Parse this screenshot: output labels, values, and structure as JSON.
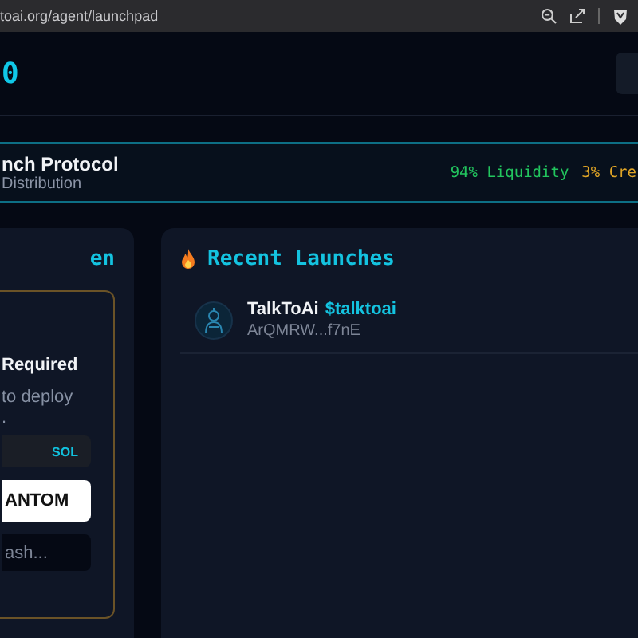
{
  "browser": {
    "url": "toai.org/agent/launchpad"
  },
  "header": {
    "logo_fragment": "0"
  },
  "banner": {
    "title": "nch Protocol",
    "subtitle": "Distribution",
    "stats": [
      {
        "text": "94% Liquidity",
        "color": "#22c55e"
      },
      {
        "text": "3% Cre",
        "color": "#e0a526"
      }
    ]
  },
  "left_panel": {
    "title": "en",
    "card": {
      "heading": "Required",
      "text_lines": [
        "to deploy",
        "."
      ],
      "amount": "SOL",
      "button": "ANTOM",
      "input": {
        "placeholder": "ash..."
      }
    }
  },
  "right_panel": {
    "title": "Recent Launches",
    "launches": [
      {
        "name": "TalkToAi",
        "ticker": "$talktoai",
        "address": "ArQMRW...f7nE"
      }
    ]
  }
}
